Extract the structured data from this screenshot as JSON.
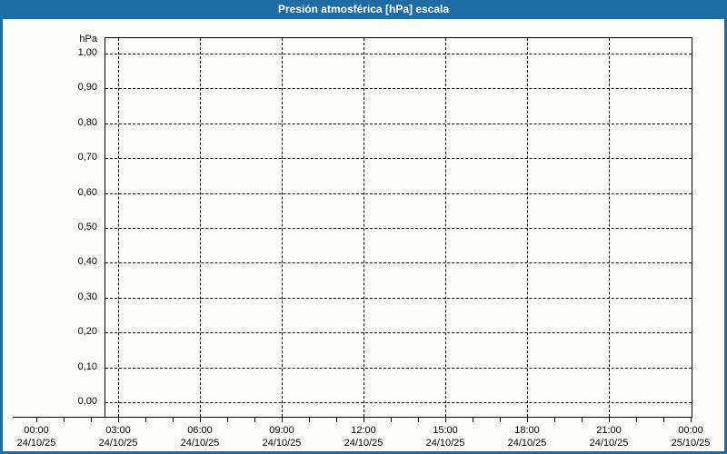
{
  "window": {
    "title": "Presión atmosférica [hPa] escala"
  },
  "colors": {
    "titlebar": "#1e6ca3",
    "window_border": "#1e6ca3",
    "title_text": "#ffffff",
    "plot_border": "#000000",
    "grid": "#000000",
    "background": "#fdfefb"
  },
  "chart_data": {
    "type": "line",
    "title": "Presión atmosférica [hPa] escala",
    "ylabel": "hPa",
    "xlabel": "",
    "ylim": [
      0.0,
      1.0
    ],
    "y_tick_step": 0.1,
    "y_ticks": [
      "1,00",
      "0,90",
      "0,80",
      "0,70",
      "0,60",
      "0,50",
      "0,40",
      "0,30",
      "0,20",
      "0,10",
      "0,00"
    ],
    "x_ticks": [
      {
        "time": "00:00",
        "date": "24/10/25"
      },
      {
        "time": "03:00",
        "date": "24/10/25"
      },
      {
        "time": "06:00",
        "date": "24/10/25"
      },
      {
        "time": "09:00",
        "date": "24/10/25"
      },
      {
        "time": "12:00",
        "date": "24/10/25"
      },
      {
        "time": "15:00",
        "date": "24/10/25"
      },
      {
        "time": "18:00",
        "date": "24/10/25"
      },
      {
        "time": "21:00",
        "date": "24/10/25"
      },
      {
        "time": "00:00",
        "date": "25/10/25"
      }
    ],
    "minor_x_ticks_per_interval": 3,
    "grid": "dashed",
    "legend": "none",
    "series": []
  }
}
